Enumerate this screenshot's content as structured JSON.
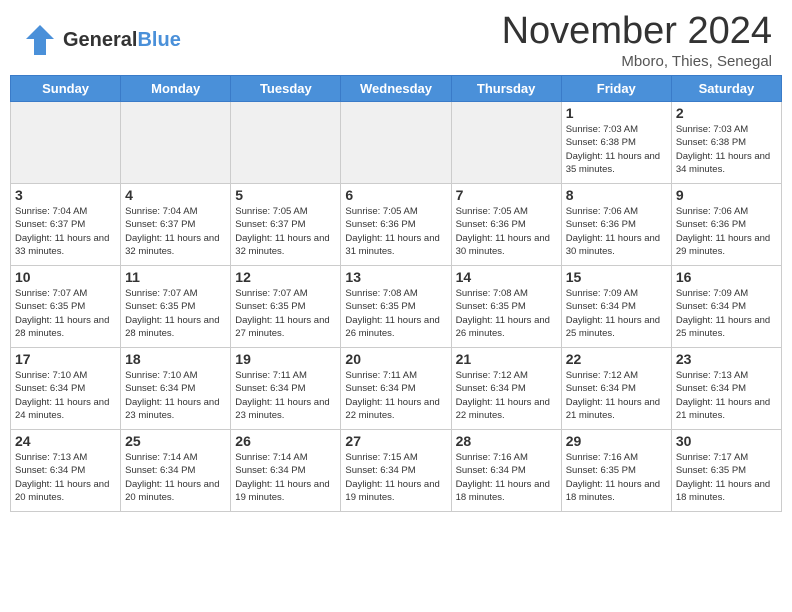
{
  "header": {
    "logo_general": "General",
    "logo_blue": "Blue",
    "month_title": "November 2024",
    "location": "Mboro, Thies, Senegal"
  },
  "days_of_week": [
    "Sunday",
    "Monday",
    "Tuesday",
    "Wednesday",
    "Thursday",
    "Friday",
    "Saturday"
  ],
  "weeks": [
    [
      {
        "day": "",
        "empty": true
      },
      {
        "day": "",
        "empty": true
      },
      {
        "day": "",
        "empty": true
      },
      {
        "day": "",
        "empty": true
      },
      {
        "day": "",
        "empty": true
      },
      {
        "day": "1",
        "sunrise": "Sunrise: 7:03 AM",
        "sunset": "Sunset: 6:38 PM",
        "daylight": "Daylight: 11 hours and 35 minutes."
      },
      {
        "day": "2",
        "sunrise": "Sunrise: 7:03 AM",
        "sunset": "Sunset: 6:38 PM",
        "daylight": "Daylight: 11 hours and 34 minutes."
      }
    ],
    [
      {
        "day": "3",
        "sunrise": "Sunrise: 7:04 AM",
        "sunset": "Sunset: 6:37 PM",
        "daylight": "Daylight: 11 hours and 33 minutes."
      },
      {
        "day": "4",
        "sunrise": "Sunrise: 7:04 AM",
        "sunset": "Sunset: 6:37 PM",
        "daylight": "Daylight: 11 hours and 32 minutes."
      },
      {
        "day": "5",
        "sunrise": "Sunrise: 7:05 AM",
        "sunset": "Sunset: 6:37 PM",
        "daylight": "Daylight: 11 hours and 32 minutes."
      },
      {
        "day": "6",
        "sunrise": "Sunrise: 7:05 AM",
        "sunset": "Sunset: 6:36 PM",
        "daylight": "Daylight: 11 hours and 31 minutes."
      },
      {
        "day": "7",
        "sunrise": "Sunrise: 7:05 AM",
        "sunset": "Sunset: 6:36 PM",
        "daylight": "Daylight: 11 hours and 30 minutes."
      },
      {
        "day": "8",
        "sunrise": "Sunrise: 7:06 AM",
        "sunset": "Sunset: 6:36 PM",
        "daylight": "Daylight: 11 hours and 30 minutes."
      },
      {
        "day": "9",
        "sunrise": "Sunrise: 7:06 AM",
        "sunset": "Sunset: 6:36 PM",
        "daylight": "Daylight: 11 hours and 29 minutes."
      }
    ],
    [
      {
        "day": "10",
        "sunrise": "Sunrise: 7:07 AM",
        "sunset": "Sunset: 6:35 PM",
        "daylight": "Daylight: 11 hours and 28 minutes."
      },
      {
        "day": "11",
        "sunrise": "Sunrise: 7:07 AM",
        "sunset": "Sunset: 6:35 PM",
        "daylight": "Daylight: 11 hours and 28 minutes."
      },
      {
        "day": "12",
        "sunrise": "Sunrise: 7:07 AM",
        "sunset": "Sunset: 6:35 PM",
        "daylight": "Daylight: 11 hours and 27 minutes."
      },
      {
        "day": "13",
        "sunrise": "Sunrise: 7:08 AM",
        "sunset": "Sunset: 6:35 PM",
        "daylight": "Daylight: 11 hours and 26 minutes."
      },
      {
        "day": "14",
        "sunrise": "Sunrise: 7:08 AM",
        "sunset": "Sunset: 6:35 PM",
        "daylight": "Daylight: 11 hours and 26 minutes."
      },
      {
        "day": "15",
        "sunrise": "Sunrise: 7:09 AM",
        "sunset": "Sunset: 6:34 PM",
        "daylight": "Daylight: 11 hours and 25 minutes."
      },
      {
        "day": "16",
        "sunrise": "Sunrise: 7:09 AM",
        "sunset": "Sunset: 6:34 PM",
        "daylight": "Daylight: 11 hours and 25 minutes."
      }
    ],
    [
      {
        "day": "17",
        "sunrise": "Sunrise: 7:10 AM",
        "sunset": "Sunset: 6:34 PM",
        "daylight": "Daylight: 11 hours and 24 minutes."
      },
      {
        "day": "18",
        "sunrise": "Sunrise: 7:10 AM",
        "sunset": "Sunset: 6:34 PM",
        "daylight": "Daylight: 11 hours and 23 minutes."
      },
      {
        "day": "19",
        "sunrise": "Sunrise: 7:11 AM",
        "sunset": "Sunset: 6:34 PM",
        "daylight": "Daylight: 11 hours and 23 minutes."
      },
      {
        "day": "20",
        "sunrise": "Sunrise: 7:11 AM",
        "sunset": "Sunset: 6:34 PM",
        "daylight": "Daylight: 11 hours and 22 minutes."
      },
      {
        "day": "21",
        "sunrise": "Sunrise: 7:12 AM",
        "sunset": "Sunset: 6:34 PM",
        "daylight": "Daylight: 11 hours and 22 minutes."
      },
      {
        "day": "22",
        "sunrise": "Sunrise: 7:12 AM",
        "sunset": "Sunset: 6:34 PM",
        "daylight": "Daylight: 11 hours and 21 minutes."
      },
      {
        "day": "23",
        "sunrise": "Sunrise: 7:13 AM",
        "sunset": "Sunset: 6:34 PM",
        "daylight": "Daylight: 11 hours and 21 minutes."
      }
    ],
    [
      {
        "day": "24",
        "sunrise": "Sunrise: 7:13 AM",
        "sunset": "Sunset: 6:34 PM",
        "daylight": "Daylight: 11 hours and 20 minutes."
      },
      {
        "day": "25",
        "sunrise": "Sunrise: 7:14 AM",
        "sunset": "Sunset: 6:34 PM",
        "daylight": "Daylight: 11 hours and 20 minutes."
      },
      {
        "day": "26",
        "sunrise": "Sunrise: 7:14 AM",
        "sunset": "Sunset: 6:34 PM",
        "daylight": "Daylight: 11 hours and 19 minutes."
      },
      {
        "day": "27",
        "sunrise": "Sunrise: 7:15 AM",
        "sunset": "Sunset: 6:34 PM",
        "daylight": "Daylight: 11 hours and 19 minutes."
      },
      {
        "day": "28",
        "sunrise": "Sunrise: 7:16 AM",
        "sunset": "Sunset: 6:34 PM",
        "daylight": "Daylight: 11 hours and 18 minutes."
      },
      {
        "day": "29",
        "sunrise": "Sunrise: 7:16 AM",
        "sunset": "Sunset: 6:35 PM",
        "daylight": "Daylight: 11 hours and 18 minutes."
      },
      {
        "day": "30",
        "sunrise": "Sunrise: 7:17 AM",
        "sunset": "Sunset: 6:35 PM",
        "daylight": "Daylight: 11 hours and 18 minutes."
      }
    ]
  ]
}
